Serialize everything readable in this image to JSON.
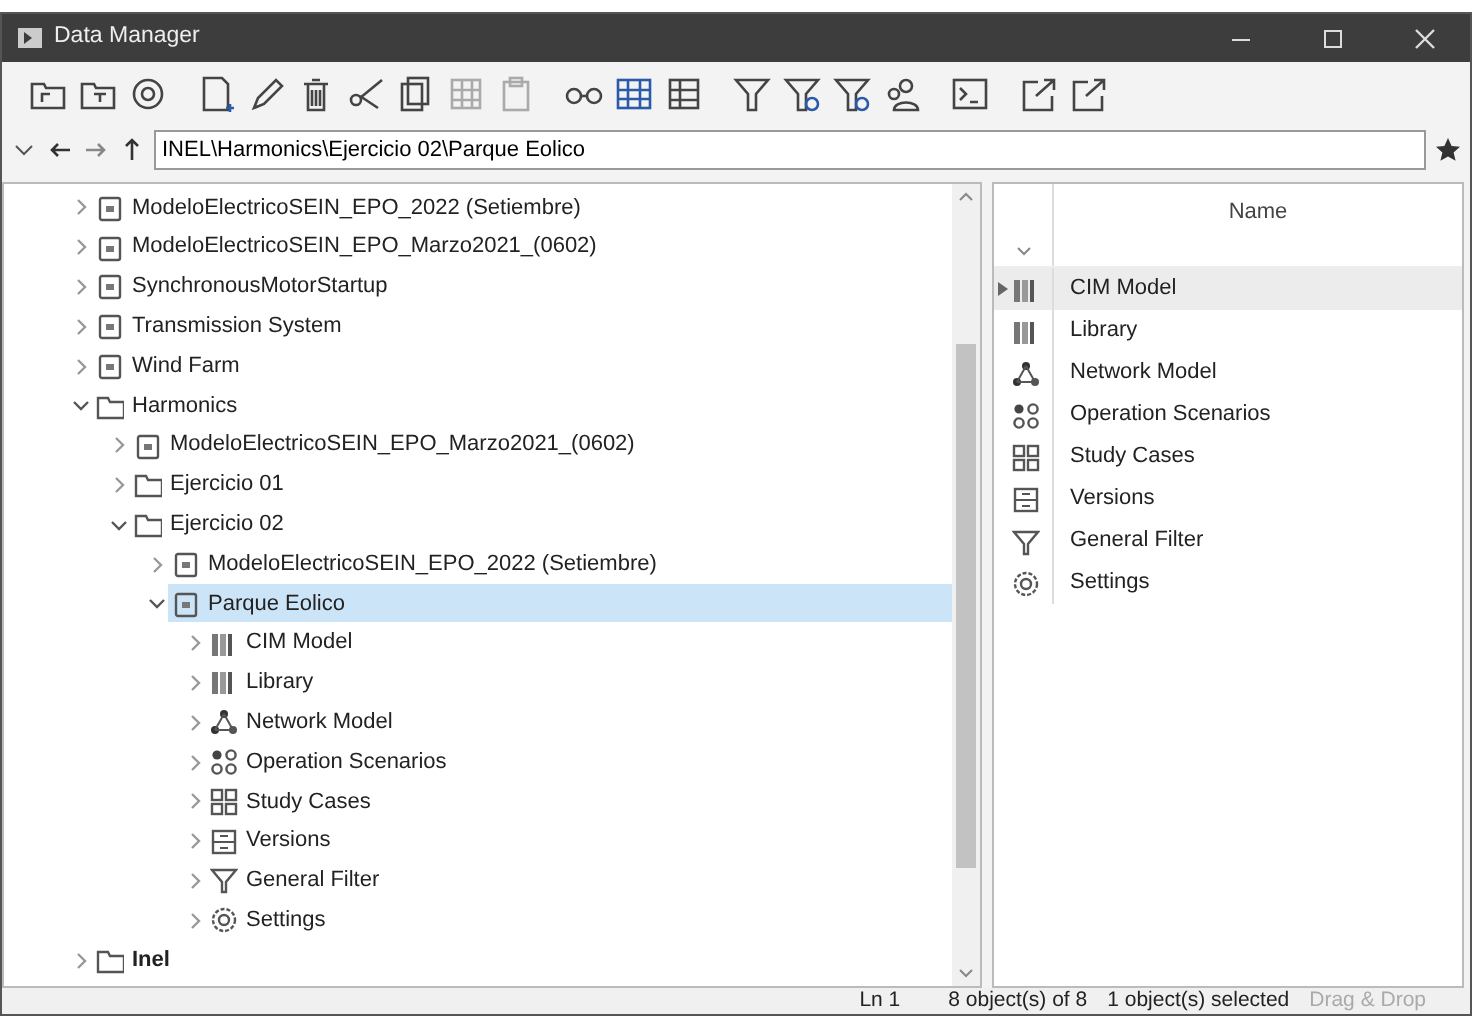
{
  "window": {
    "title": "Data Manager"
  },
  "address": {
    "path": "INEL\\Harmonics\\Ejercicio 02\\Parque Eolico"
  },
  "tree": [
    {
      "label": "ModeloElectricoSEIN_EPO_2022 (Setiembre)",
      "kind": "project",
      "expanded": false,
      "selected": false,
      "active": false
    },
    {
      "label": "ModeloElectricoSEIN_EPO_Marzo2021_(0602)",
      "kind": "project",
      "expanded": false,
      "selected": false,
      "active": false
    },
    {
      "label": "SynchronousMotorStartup",
      "kind": "project",
      "expanded": false,
      "selected": false,
      "active": false
    },
    {
      "label": "Transmission System",
      "kind": "project",
      "expanded": false,
      "selected": false,
      "active": false
    },
    {
      "label": "Wind Farm",
      "kind": "project",
      "expanded": false,
      "selected": false,
      "active": false
    },
    {
      "label": "Harmonics",
      "kind": "folder",
      "expanded": true,
      "selected": false,
      "active": false,
      "children": [
        {
          "label": "ModeloElectricoSEIN_EPO_Marzo2021_(0602)",
          "kind": "project",
          "expanded": false,
          "selected": false,
          "active": false
        },
        {
          "label": "Ejercicio 01",
          "kind": "folder",
          "expanded": false,
          "selected": false,
          "active": false
        },
        {
          "label": "Ejercicio 02",
          "kind": "folder",
          "expanded": true,
          "selected": false,
          "active": false,
          "children": [
            {
              "label": "ModeloElectricoSEIN_EPO_2022 (Setiembre)",
              "kind": "project",
              "expanded": false,
              "selected": false,
              "active": false
            },
            {
              "label": "Parque Eolico",
              "kind": "project",
              "expanded": true,
              "selected": true,
              "active": false,
              "children": [
                {
                  "label": "CIM Model",
                  "kind": "library",
                  "expanded": false,
                  "selected": false,
                  "active": false
                },
                {
                  "label": "Library",
                  "kind": "library",
                  "expanded": false,
                  "selected": false,
                  "active": false
                },
                {
                  "label": "Network Model",
                  "kind": "network",
                  "expanded": false,
                  "selected": false,
                  "active": false
                },
                {
                  "label": "Operation Scenarios",
                  "kind": "scenarios",
                  "expanded": false,
                  "selected": false,
                  "active": false
                },
                {
                  "label": "Study Cases",
                  "kind": "studycases",
                  "expanded": false,
                  "selected": false,
                  "active": false
                },
                {
                  "label": "Versions",
                  "kind": "versions",
                  "expanded": false,
                  "selected": false,
                  "active": false
                },
                {
                  "label": "General Filter",
                  "kind": "filter",
                  "expanded": false,
                  "selected": false,
                  "active": false
                },
                {
                  "label": "Settings",
                  "kind": "settings",
                  "expanded": false,
                  "selected": false,
                  "active": false
                }
              ]
            }
          ]
        }
      ]
    },
    {
      "label": "Inel",
      "kind": "folder",
      "expanded": false,
      "selected": false,
      "active": true
    }
  ],
  "list": {
    "columns": [
      "Name"
    ],
    "rows": [
      {
        "name": "CIM Model",
        "kind": "library",
        "selected": true
      },
      {
        "name": "Library",
        "kind": "library",
        "selected": false
      },
      {
        "name": "Network Model",
        "kind": "network",
        "selected": false
      },
      {
        "name": "Operation Scenarios",
        "kind": "scenarios",
        "selected": false
      },
      {
        "name": "Study Cases",
        "kind": "studycases",
        "selected": false
      },
      {
        "name": "Versions",
        "kind": "versions",
        "selected": false
      },
      {
        "name": "General Filter",
        "kind": "filter",
        "selected": false
      },
      {
        "name": "Settings",
        "kind": "settings",
        "selected": false
      }
    ]
  },
  "status_bar": {
    "line": "Ln 1",
    "count": "8 object(s) of 8",
    "selection": "1 object(s) selected",
    "mode": {
      "label": "Drag & Drop",
      "disabled": true
    }
  }
}
